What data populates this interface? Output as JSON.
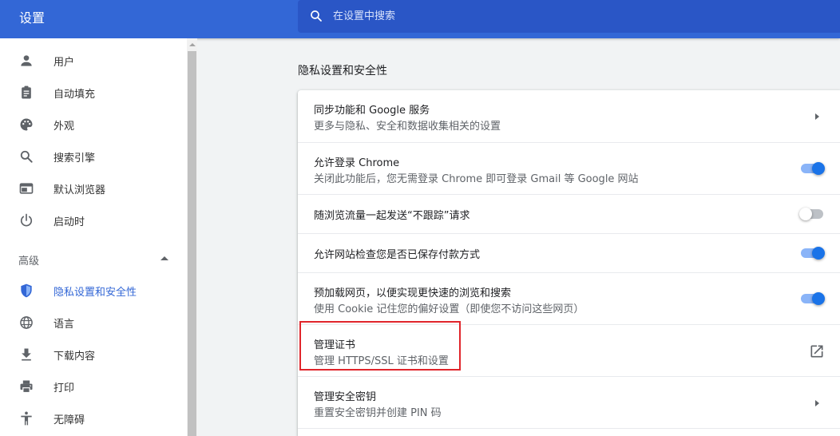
{
  "header": {
    "title": "设置",
    "search_placeholder": "在设置中搜索"
  },
  "sidebar": {
    "items": [
      {
        "label": "用户",
        "icon": "person-icon"
      },
      {
        "label": "自动填充",
        "icon": "clipboard-icon"
      },
      {
        "label": "外观",
        "icon": "palette-icon"
      },
      {
        "label": "搜索引擎",
        "icon": "search-icon"
      },
      {
        "label": "默认浏览器",
        "icon": "browser-window-icon"
      },
      {
        "label": "启动时",
        "icon": "power-icon"
      }
    ],
    "advanced_label": "高级",
    "advanced_items": [
      {
        "label": "隐私设置和安全性",
        "icon": "shield-icon",
        "active": true
      },
      {
        "label": "语言",
        "icon": "globe-icon"
      },
      {
        "label": "下载内容",
        "icon": "download-icon"
      },
      {
        "label": "打印",
        "icon": "printer-icon"
      },
      {
        "label": "无障碍",
        "icon": "accessibility-icon"
      }
    ]
  },
  "main": {
    "section_title": "隐私设置和安全性",
    "rows": [
      {
        "title": "同步功能和 Google 服务",
        "subtitle": "更多与隐私、安全和数据收集相关的设置",
        "control": "arrow"
      },
      {
        "title": "允许登录 Chrome",
        "subtitle": "关闭此功能后，您无需登录 Chrome 即可登录 Gmail 等 Google 网站",
        "control": "toggle",
        "on": true
      },
      {
        "title": "随浏览流量一起发送“不跟踪”请求",
        "control": "toggle",
        "on": false
      },
      {
        "title": "允许网站检查您是否已保存付款方式",
        "control": "toggle",
        "on": true
      },
      {
        "title": "预加载网页，以便实现更快速的浏览和搜索",
        "subtitle": "使用 Cookie 记住您的偏好设置（即使您不访问这些网页）",
        "control": "toggle",
        "on": true
      },
      {
        "title": "管理证书",
        "subtitle": "管理 HTTPS/SSL 证书和设置",
        "control": "external-link"
      },
      {
        "title": "管理安全密钥",
        "subtitle": "重置安全密钥并创建 PIN 码",
        "control": "arrow"
      }
    ]
  },
  "colors": {
    "header_bg": "#3367d6",
    "accent": "#1a73e8",
    "highlight_border": "#e0252b"
  }
}
